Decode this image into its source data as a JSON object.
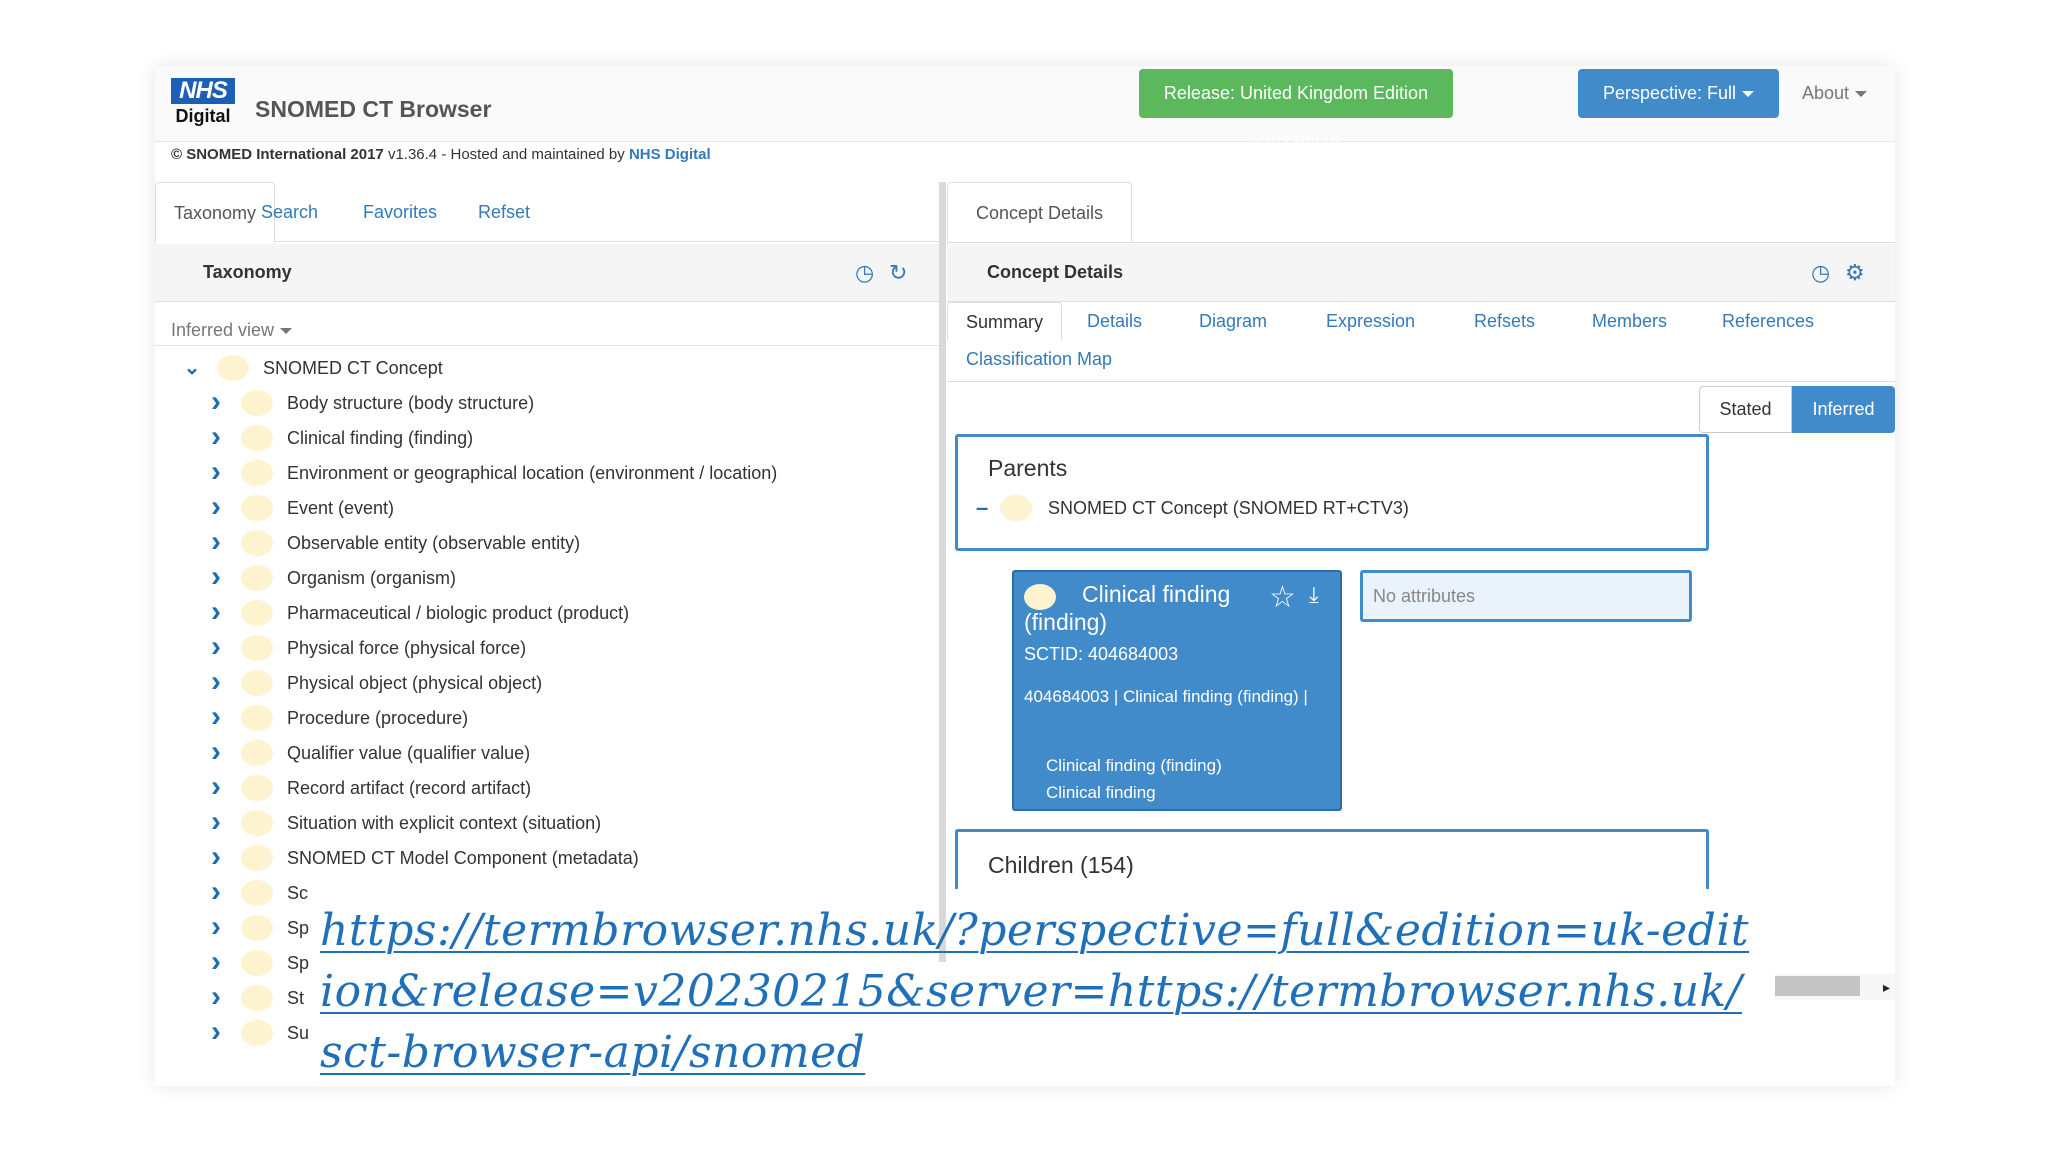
{
  "logo": {
    "top": "NHS",
    "bottom": "Digital"
  },
  "app_title": "SNOMED CT Browser",
  "header": {
    "release_button": "Release: United Kingdom Edition v20230215",
    "perspective_button": "Perspective: Full",
    "about_menu": "About"
  },
  "copyright": {
    "brand": "© SNOMED International 2017",
    "text": " v1.36.4 - Hosted and maintained by ",
    "link": "NHS Digital"
  },
  "left_tabs": [
    "Taxonomy",
    "Search",
    "Favorites",
    "Refset"
  ],
  "taxonomy": {
    "title": "Taxonomy",
    "view_select": "Inferred view",
    "root": "SNOMED CT Concept",
    "children": [
      "Body structure (body structure)",
      "Clinical finding (finding)",
      "Environment or geographical location (environment / location)",
      "Event (event)",
      "Observable entity (observable entity)",
      "Organism (organism)",
      "Pharmaceutical / biologic product (product)",
      "Physical force (physical force)",
      "Physical object (physical object)",
      "Procedure (procedure)",
      "Qualifier value (qualifier value)",
      "Record artifact (record artifact)",
      "Situation with explicit context (situation)",
      "SNOMED CT Model Component (metadata)",
      "Sc",
      "Sp",
      "Sp",
      "St",
      "Su"
    ]
  },
  "right": {
    "tab": "Concept Details",
    "panel_title": "Concept Details",
    "subtabs": [
      "Summary",
      "Details",
      "Diagram",
      "Expression",
      "Refsets",
      "Members",
      "References",
      "Classification Map"
    ],
    "toggle": {
      "stated": "Stated",
      "inferred": "Inferred"
    },
    "parents": {
      "title": "Parents",
      "items": [
        "SNOMED CT Concept (SNOMED RT+CTV3)"
      ]
    },
    "concept": {
      "name": "Clinical finding (finding)",
      "sctid": "SCTID: 404684003",
      "id_line": "404684003 | Clinical finding (finding) |",
      "synonyms": [
        "Clinical finding (finding)",
        "Clinical finding"
      ]
    },
    "attributes": "No attributes",
    "children_title": "Children (154)"
  },
  "url_overlay": "https://termbrowser.nhs.uk/?perspective=full&edition=uk-edition&release=v20230215&server=https://termbrowser.nhs.uk/sct-browser-api/snomed",
  "colors": {
    "primary": "#428bca",
    "success": "#5cb85c",
    "nhs_blue": "#1c5fb4",
    "link": "#337ab7",
    "concept_dot": "#fdf3cf"
  }
}
